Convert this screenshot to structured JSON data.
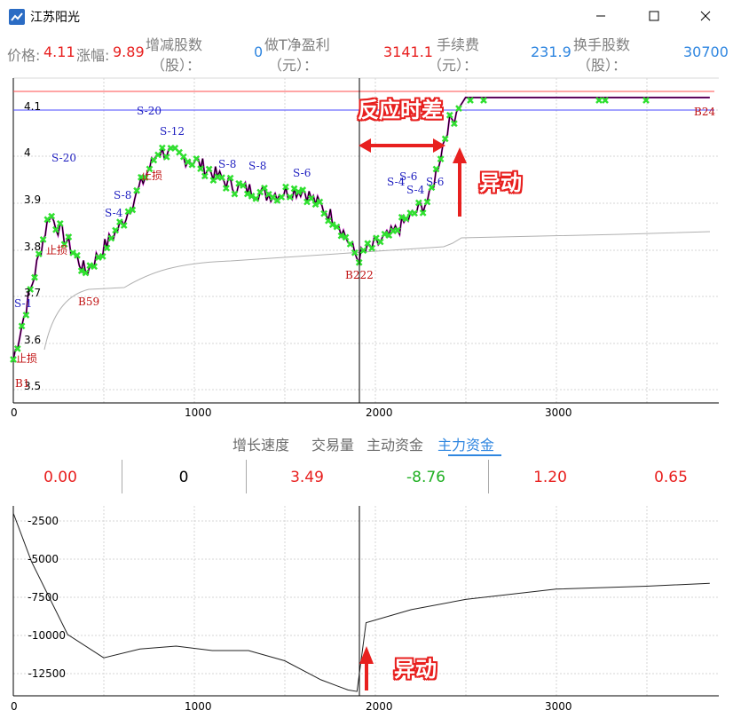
{
  "window": {
    "title": "江苏阳光",
    "controls": {
      "minimize": "minimize-icon",
      "maximize": "maximize-icon",
      "close": "close-icon"
    }
  },
  "stats": {
    "price_label": "价格:",
    "price_value": "4.11",
    "change_label": "涨幅:",
    "change_value": "9.89",
    "shares_delta_label_1": "增减股数",
    "shares_delta_label_2": "（股）：",
    "shares_delta_value": "0",
    "t_profit_label_1": "做T净盈利",
    "t_profit_label_2": "（元）：",
    "t_profit_value": "3141.1",
    "fee_label_1": "手续费",
    "fee_label_2": "（元）：",
    "fee_value": "231.9",
    "turnover_label_1": "换手股数",
    "turnover_label_2": "（股）：",
    "turnover_value": "30700"
  },
  "main_chart": {
    "y_ticks": [
      "4.1",
      "4",
      "3.9",
      "3.8",
      "3.7",
      "3.6",
      "3.5"
    ],
    "x_ticks": [
      "0",
      "1000",
      "2000",
      "3000"
    ],
    "labels": {
      "b59": "B59",
      "b222": "B222",
      "b24": "B24",
      "b1": "B1",
      "s1": "S-1",
      "s20a": "S-20",
      "s20b": "S-20",
      "s12": "S-12",
      "s8": "S-8",
      "s6": "S-6",
      "s4": "S-4",
      "stop_loss": "止损"
    }
  },
  "annotations": {
    "reaction_lag": "反应时差",
    "abnormal_move_1": "异动",
    "abnormal_move_2": "异动"
  },
  "tabs": [
    {
      "label": "增长速度",
      "active": false
    },
    {
      "label": "交易量",
      "active": false
    },
    {
      "label": "主动资金",
      "active": false
    },
    {
      "label": "主力资金",
      "active": true
    }
  ],
  "values": [
    {
      "text": "0.00",
      "color": "#e8201f"
    },
    {
      "text": "0",
      "color": "#000000"
    },
    {
      "text": "3.49",
      "color": "#e8201f"
    },
    {
      "text": "-8.76",
      "color": "#21b024"
    },
    {
      "text": "1.20",
      "color": "#e8201f"
    },
    {
      "text": "0.65",
      "color": "#e8201f"
    }
  ],
  "sub_chart": {
    "y_ticks": [
      "-2500",
      "-5000",
      "-7500",
      "-10000",
      "-12500"
    ],
    "x_ticks": [
      "0",
      "1000",
      "2000",
      "3000"
    ]
  },
  "chart_data": [
    {
      "type": "line",
      "x": [
        0,
        200,
        400,
        600,
        800,
        1000,
        1200,
        1400,
        1600,
        1800,
        1900,
        2100,
        2300,
        2400,
        2500,
        3000,
        3500,
        3850
      ],
      "series": [
        {
          "values": [
            3.57,
            3.87,
            3.75,
            3.85,
            4.0,
            3.98,
            3.93,
            3.91,
            3.92,
            3.85,
            3.78,
            3.83,
            3.9,
            4.05,
            4.11,
            4.11,
            4.11,
            4.11
          ]
        }
      ],
      "xlim": [
        0,
        3900
      ],
      "ylim": [
        3.48,
        4.15
      ],
      "reference_lines": [
        4.12,
        4.1
      ]
    },
    {
      "type": "line",
      "x": [
        0,
        100,
        300,
        500,
        700,
        900,
        1100,
        1300,
        1500,
        1700,
        1850,
        1900,
        1950,
        2200,
        2500,
        3000,
        3500,
        3850
      ],
      "series": [
        {
          "values": [
            -1500,
            -4800,
            -9800,
            -11400,
            -10800,
            -10600,
            -10900,
            -10900,
            -11600,
            -12900,
            -13600,
            -13700,
            -9000,
            -8100,
            -7400,
            -6700,
            -6500,
            -6300
          ]
        }
      ],
      "xlim": [
        0,
        3900
      ],
      "ylim": [
        -14000,
        -1000
      ]
    }
  ]
}
